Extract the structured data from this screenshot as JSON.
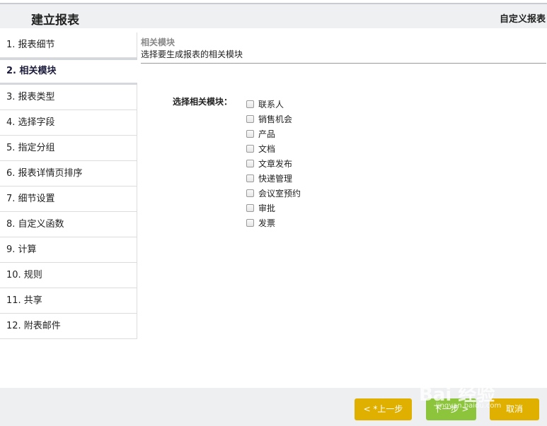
{
  "header": {
    "title": "建立报表",
    "right_title": "自定义报表"
  },
  "sidebar": {
    "steps": [
      {
        "label": "1. 报表细节"
      },
      {
        "label": "2. 相关模块",
        "active": true
      },
      {
        "label": "3. 报表类型"
      },
      {
        "label": "4. 选择字段"
      },
      {
        "label": "5. 指定分组"
      },
      {
        "label": "6. 报表详情页排序"
      },
      {
        "label": "7. 细节设置"
      },
      {
        "label": "8. 自定义函数"
      },
      {
        "label": "9. 计算"
      },
      {
        "label": "10. 规则"
      },
      {
        "label": "11. 共享"
      },
      {
        "label": "12. 附表邮件"
      }
    ]
  },
  "content": {
    "section_title": "相关模块",
    "section_subtitle": "选择要生成报表的相关模块",
    "module_select_label": "选择相关模块：",
    "modules": [
      {
        "label": "联系人",
        "checked": false
      },
      {
        "label": "销售机会",
        "checked": false
      },
      {
        "label": "产品",
        "checked": false
      },
      {
        "label": "文档",
        "checked": false
      },
      {
        "label": "文章发布",
        "checked": false
      },
      {
        "label": "快递管理",
        "checked": false
      },
      {
        "label": "会议室预约",
        "checked": false
      },
      {
        "label": "审批",
        "checked": false
      },
      {
        "label": "发票",
        "checked": false
      }
    ]
  },
  "footer": {
    "prev_label": "< *上一步",
    "next_label": "下一步 >",
    "cancel_label": "取消"
  },
  "watermark": {
    "text": "Bai 经验",
    "url": "jingyan.baidu.com"
  }
}
